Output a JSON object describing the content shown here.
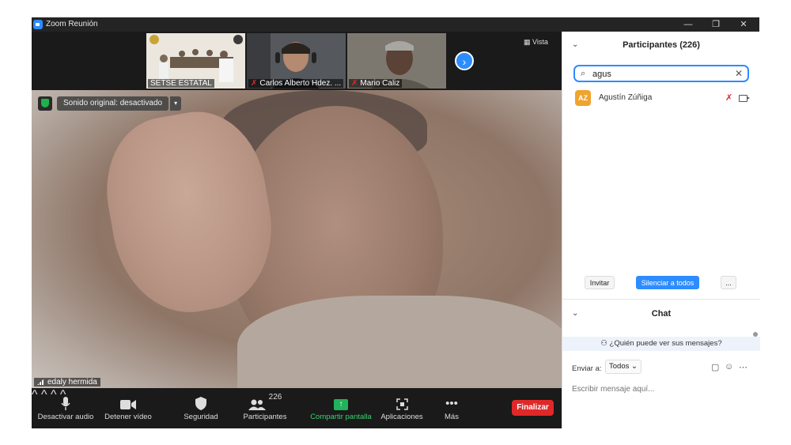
{
  "window": {
    "title": "Zoom Reunión",
    "minimize": "—",
    "restore": "❐",
    "close": "✕"
  },
  "thumbnails": [
    {
      "name": "SETSE ESTATAL",
      "muted": false
    },
    {
      "name": "Carlos Alberto Hdez. ...",
      "muted": true
    },
    {
      "name": "Mario Caliz",
      "muted": true
    }
  ],
  "view_label": "Vista",
  "main_video": {
    "speaker": "edaly hermida",
    "sound_label": "Sonido original: desactivado"
  },
  "toolbar": {
    "audio": "Desactivar audio",
    "video": "Detener vídeo",
    "security": "Seguridad",
    "participants": "Participantes",
    "participants_count": "226",
    "share": "Compartir pantalla",
    "apps": "Aplicaciones",
    "more": "Más",
    "end": "Finalizar"
  },
  "participants_panel": {
    "title": "Participantes (226)",
    "search_value": "agus",
    "results": [
      {
        "initials": "AZ",
        "name": "Agustín Zúñiga"
      }
    ],
    "invite": "Invitar",
    "mute_all": "Silenciar a todos",
    "more": "..."
  },
  "chat_panel": {
    "title": "Chat",
    "who_can_see": "¿Quién puede ver sus mensajes?",
    "send_to_label": "Enviar a:",
    "send_to_value": "Todos",
    "message_placeholder": "Escribir mensaje aquí..."
  }
}
